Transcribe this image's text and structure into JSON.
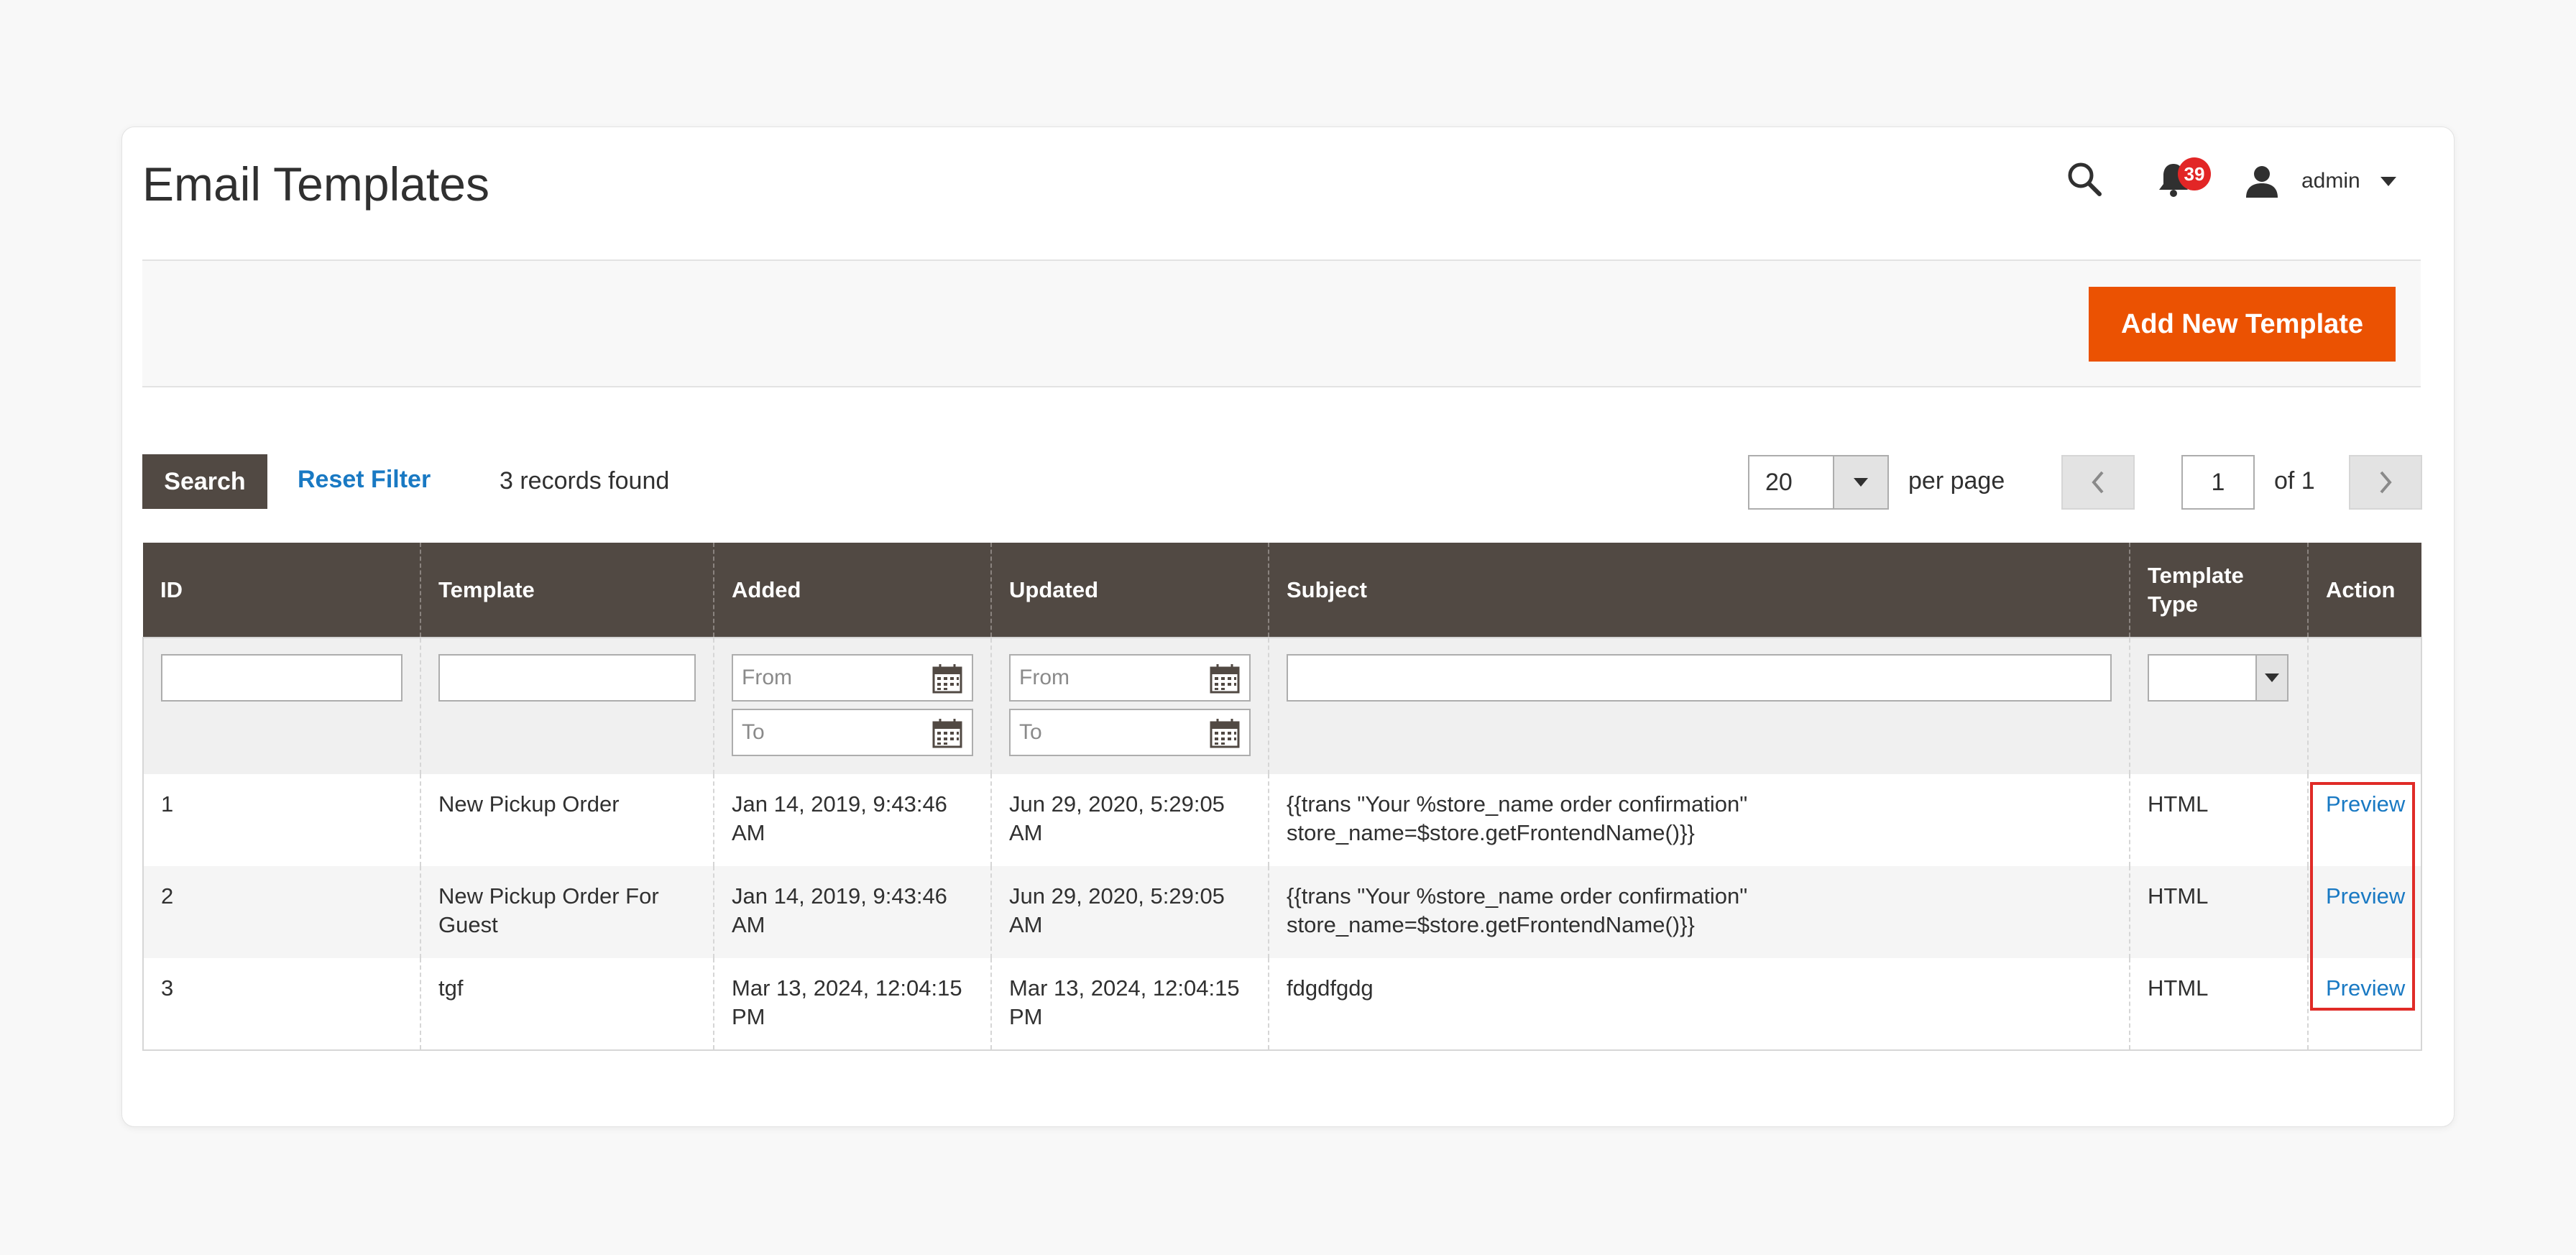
{
  "page": {
    "title": "Email Templates"
  },
  "header": {
    "notifications_count": "39",
    "user_name": "admin"
  },
  "actions": {
    "add_button": "Add New Template"
  },
  "toolbar": {
    "search_label": "Search",
    "reset_label": "Reset Filter",
    "records_found": "3 records found",
    "per_page_value": "20",
    "per_page_label": "per page",
    "current_page": "1",
    "of_pages": "of 1"
  },
  "columns": [
    "ID",
    "Template",
    "Added",
    "Updated",
    "Subject",
    "Template Type",
    "Action"
  ],
  "filters": {
    "from_placeholder": "From",
    "to_placeholder": "To"
  },
  "rows": [
    {
      "id": "1",
      "template": "New Pickup Order",
      "added": "Jan 14, 2019, 9:43:46 AM",
      "updated": "Jun 29, 2020, 5:29:05 AM",
      "subject": "{{trans \"Your %store_name order confirmation\" store_name=$store.getFrontendName()}}",
      "type": "HTML",
      "action": "Preview"
    },
    {
      "id": "2",
      "template": "New Pickup Order For Guest",
      "added": "Jan 14, 2019, 9:43:46 AM",
      "updated": "Jun 29, 2020, 5:29:05 AM",
      "subject": "{{trans \"Your %store_name order confirmation\" store_name=$store.getFrontendName()}}",
      "type": "HTML",
      "action": "Preview"
    },
    {
      "id": "3",
      "template": "tgf",
      "added": "Mar 13, 2024, 12:04:15 PM",
      "updated": "Mar 13, 2024, 12:04:15 PM",
      "subject": "fdgdfgdg",
      "type": "HTML",
      "action": "Preview"
    }
  ],
  "colors": {
    "accent": "#eb5202",
    "header_bg": "#514943",
    "link": "#1979c3",
    "badge": "#e22626",
    "highlight": "#e02b27"
  },
  "icons": [
    "search-icon",
    "bell-icon",
    "user-icon",
    "calendar-icon",
    "chevron-left-icon",
    "chevron-right-icon",
    "caret-down-icon"
  ]
}
